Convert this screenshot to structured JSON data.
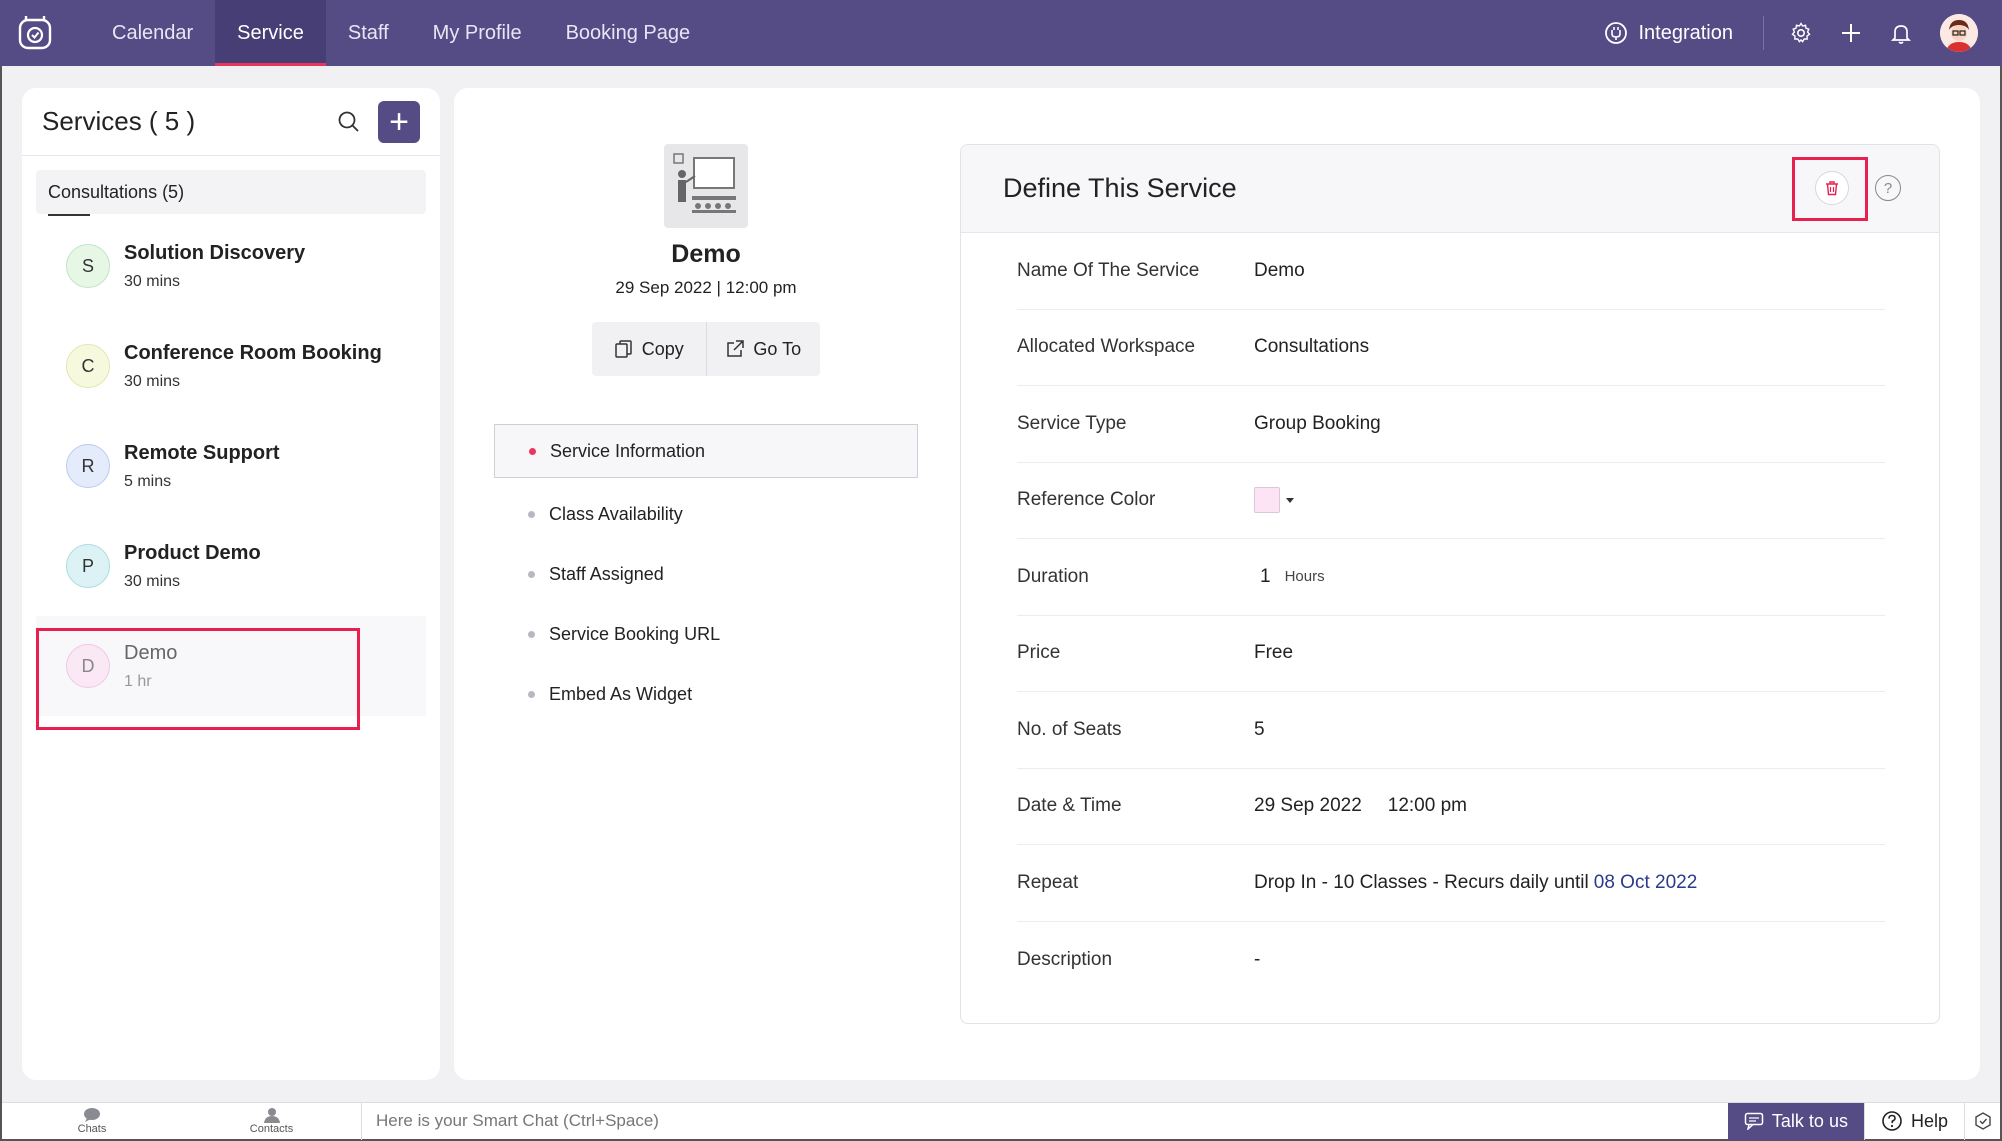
{
  "nav": {
    "tabs": [
      {
        "label": "Calendar"
      },
      {
        "label": "Service"
      },
      {
        "label": "Staff"
      },
      {
        "label": "My Profile"
      },
      {
        "label": "Booking Page"
      }
    ],
    "active_tab": "Service",
    "integration_label": "Integration"
  },
  "left_panel": {
    "title": "Services ( 5 )",
    "add_label": "+",
    "workspace": "Consultations (5)",
    "services": [
      {
        "initial": "S",
        "name": "Solution Discovery",
        "duration": "30 mins",
        "color": "#e6f7e6"
      },
      {
        "initial": "C",
        "name": "Conference Room Booking",
        "duration": "30 mins",
        "color": "#f7f9df"
      },
      {
        "initial": "R",
        "name": "Remote Support",
        "duration": "5 mins",
        "color": "#e4ebfa"
      },
      {
        "initial": "P",
        "name": "Product Demo",
        "duration": "30 mins",
        "color": "#dcf2f5"
      },
      {
        "initial": "D",
        "name": "Demo",
        "duration": "1 hr",
        "color": "#fbe8f5"
      }
    ]
  },
  "service_summary": {
    "name": "Demo",
    "date": "29 Sep 2022 | 12:00 pm",
    "copy_label": "Copy",
    "goto_label": "Go To"
  },
  "side_menu": [
    {
      "label": "Service Information"
    },
    {
      "label": "Class Availability"
    },
    {
      "label": "Staff Assigned"
    },
    {
      "label": "Service Booking URL"
    },
    {
      "label": "Embed As Widget"
    }
  ],
  "define": {
    "title": "Define This Service",
    "help": "?",
    "fields": {
      "name_label": "Name Of The Service",
      "name_value": "Demo",
      "workspace_label": "Allocated Workspace",
      "workspace_value": "Consultations",
      "type_label": "Service Type",
      "type_value": "Group Booking",
      "color_label": "Reference Color",
      "color_value": "#fde4f4",
      "duration_label": "Duration",
      "duration_value": "1",
      "duration_unit": "Hours",
      "price_label": "Price",
      "price_value": "Free",
      "seats_label": "No. of Seats",
      "seats_value": "5",
      "datetime_label": "Date & Time",
      "date_value": "29 Sep 2022",
      "time_value": "12:00 pm",
      "repeat_label": "Repeat",
      "repeat_value": "Drop In - 10 Classes - Recurs daily until",
      "repeat_until": "08 Oct 2022",
      "description_label": "Description",
      "description_value": "-"
    }
  },
  "bottom": {
    "chats": "Chats",
    "contacts": "Contacts",
    "smartchat_placeholder": "Here is your Smart Chat (Ctrl+Space)",
    "talk": "Talk to us",
    "help": "Help"
  },
  "colors": {
    "brand": "#554c86",
    "accent": "#e8365d",
    "highlight": "#e8204f"
  }
}
